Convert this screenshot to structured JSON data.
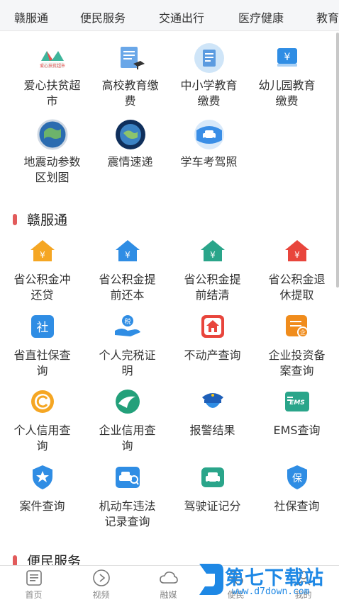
{
  "top_nav": {
    "tabs": [
      "赣服通",
      "便民服务",
      "交通出行",
      "医疗健康",
      "教育"
    ]
  },
  "grid_top": [
    {
      "label": "爱心扶贫超市",
      "icon": "charity-market-icon"
    },
    {
      "label": "高校教育缴费",
      "icon": "university-fee-icon"
    },
    {
      "label": "中小学教育缴费",
      "icon": "school-fee-icon"
    },
    {
      "label": "幼儿园教育缴费",
      "icon": "kindergarten-fee-icon"
    },
    {
      "label": "地震动参数区划图",
      "icon": "earthquake-map-icon"
    },
    {
      "label": "震情速递",
      "icon": "earthquake-news-icon"
    },
    {
      "label": "学车考驾照",
      "icon": "driving-license-car-icon"
    }
  ],
  "section_ganfutong": {
    "title": "赣服通",
    "items": [
      {
        "label": "省公积金冲还贷",
        "icon": "housing-fund-repay-icon"
      },
      {
        "label": "省公积金提前还本",
        "icon": "housing-fund-prepay-icon"
      },
      {
        "label": "省公积金提前结清",
        "icon": "housing-fund-settle-icon"
      },
      {
        "label": "省公积金退休提取",
        "icon": "housing-fund-retire-icon"
      },
      {
        "label": "省直社保查询",
        "icon": "social-security-icon"
      },
      {
        "label": "个人完税证明",
        "icon": "tax-certificate-icon"
      },
      {
        "label": "不动产查询",
        "icon": "real-estate-icon"
      },
      {
        "label": "企业投资备案查询",
        "icon": "enterprise-invest-icon"
      },
      {
        "label": "个人信用查询",
        "icon": "personal-credit-icon"
      },
      {
        "label": "企业信用查询",
        "icon": "enterprise-credit-icon"
      },
      {
        "label": "报警结果",
        "icon": "police-report-icon"
      },
      {
        "label": "EMS查询",
        "icon": "ems-icon"
      },
      {
        "label": "案件查询",
        "icon": "case-query-icon"
      },
      {
        "label": "机动车违法记录查询",
        "icon": "vehicle-violation-icon"
      },
      {
        "label": "驾驶证记分",
        "icon": "driving-score-icon"
      },
      {
        "label": "社保查询",
        "icon": "social-insurance-icon"
      }
    ]
  },
  "section_bianmin": {
    "title": "便民服务"
  },
  "bottom_tabs": [
    {
      "label": "首页",
      "icon": "home-doc-icon"
    },
    {
      "label": "视频",
      "icon": "video-play-icon"
    },
    {
      "label": "融媒",
      "icon": "cloud-icon"
    },
    {
      "label": "便民",
      "icon": "service-icon"
    },
    {
      "label": "我的",
      "icon": "user-icon"
    }
  ],
  "watermark": {
    "title": "第七下载站",
    "url": "www.d7down.com"
  }
}
